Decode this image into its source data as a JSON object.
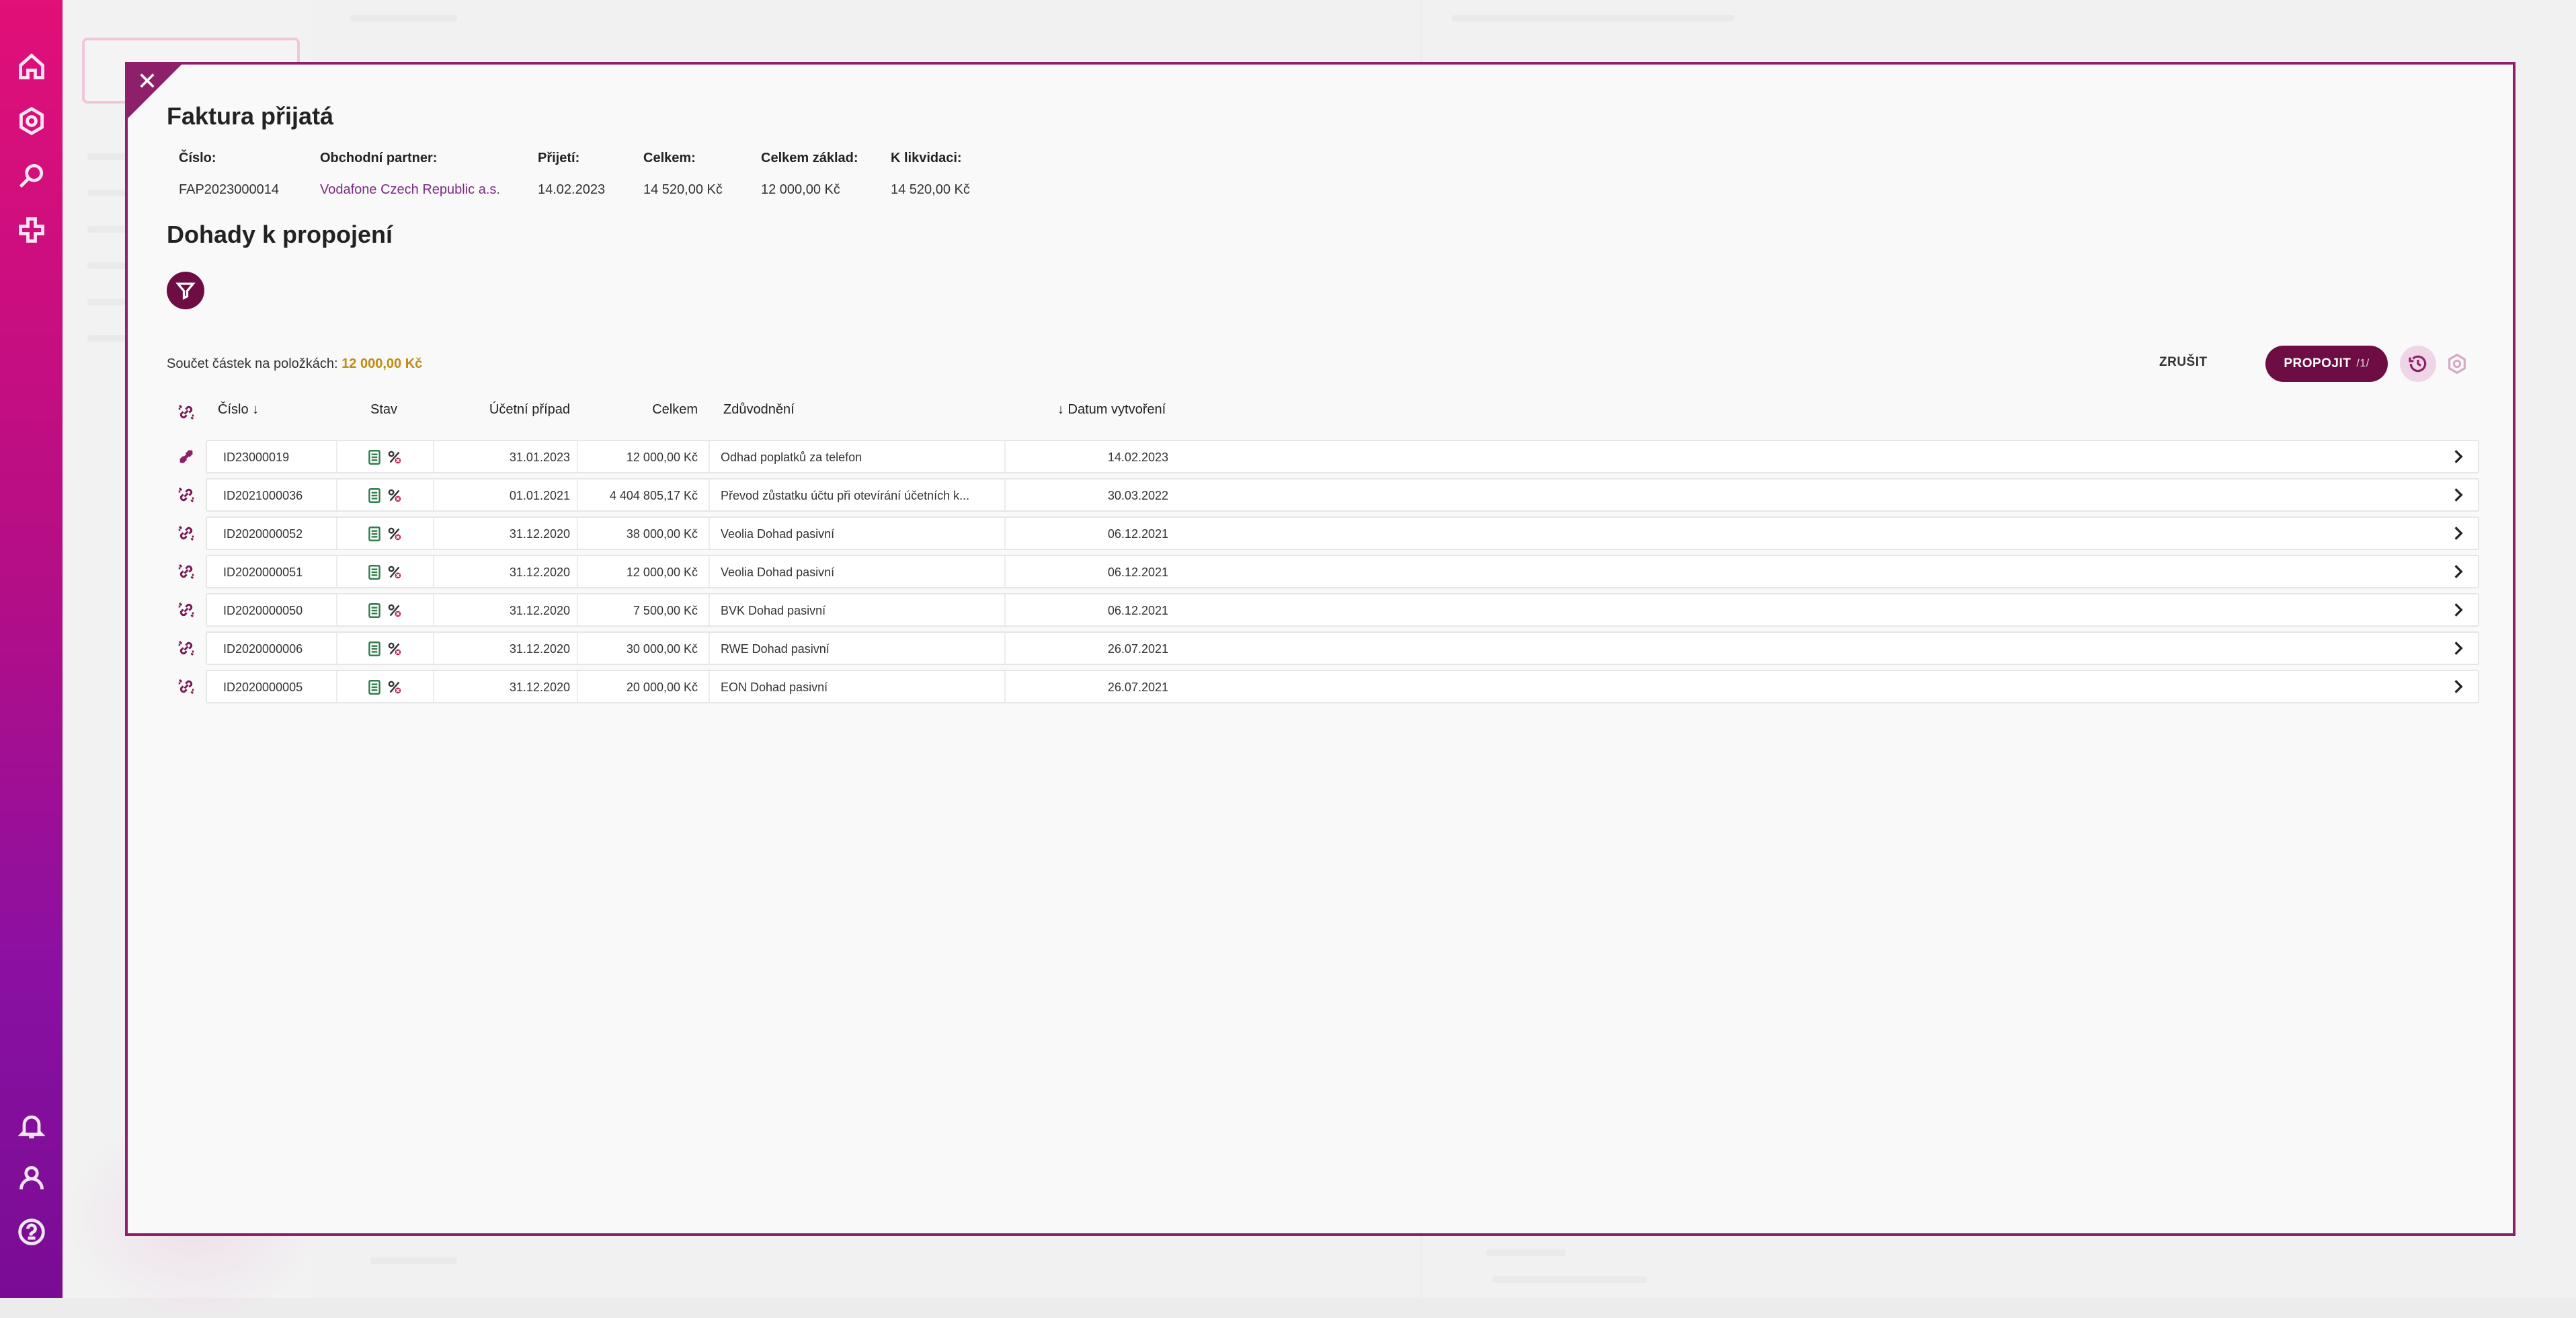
{
  "rail": {
    "top_icons": [
      "home-icon",
      "settings-icon",
      "search-icon",
      "plus-icon"
    ],
    "bottom_icons": [
      "bell-icon",
      "user-icon",
      "help-icon"
    ]
  },
  "modal": {
    "title": "Faktura přijatá",
    "info": [
      {
        "label": "Číslo:",
        "value": "FAP2023000014",
        "link": false
      },
      {
        "label": "Obchodní partner:",
        "value": "Vodafone Czech Republic a.s.",
        "link": true
      },
      {
        "label": "Přijetí:",
        "value": "14.02.2023",
        "link": false
      },
      {
        "label": "Celkem:",
        "value": "14 520,00 Kč",
        "link": false
      },
      {
        "label": "Celkem základ:",
        "value": "12 000,00 Kč",
        "link": false
      },
      {
        "label": "K likvidaci:",
        "value": "14 520,00 Kč",
        "link": false
      }
    ],
    "section_title": "Dohady k propojení",
    "sum_label": "Součet částek na položkách:",
    "sum_value": "12 000,00 Kč",
    "cancel_label": "ZRUŠIT",
    "link_label": "PROPOJIT",
    "link_count": "/1/",
    "table": {
      "headers": {
        "cislo": "Číslo ↓",
        "stav": "Stav",
        "ucetni_pripad": "Účetní případ",
        "celkem": "Celkem",
        "zduvodneni": "Zdůvodnění",
        "datum": "↓ Datum vytvoření"
      },
      "rows": [
        {
          "linked": true,
          "cislo": "ID23000019",
          "ucetni_pripad": "31.01.2023",
          "celkem": "12 000,00 Kč",
          "zduvodneni": "Odhad poplatků za telefon",
          "datum": "14.02.2023"
        },
        {
          "linked": false,
          "cislo": "ID2021000036",
          "ucetni_pripad": "01.01.2021",
          "celkem": "4 404 805,17 Kč",
          "zduvodneni": "Převod zůstatku účtu při otevírání účetních k...",
          "datum": "30.03.2022"
        },
        {
          "linked": false,
          "cislo": "ID2020000052",
          "ucetni_pripad": "31.12.2020",
          "celkem": "38 000,00 Kč",
          "zduvodneni": "Veolia Dohad pasivní",
          "datum": "06.12.2021"
        },
        {
          "linked": false,
          "cislo": "ID2020000051",
          "ucetni_pripad": "31.12.2020",
          "celkem": "12 000,00 Kč",
          "zduvodneni": "Veolia Dohad pasivní",
          "datum": "06.12.2021"
        },
        {
          "linked": false,
          "cislo": "ID2020000050",
          "ucetni_pripad": "31.12.2020",
          "celkem": "7 500,00 Kč",
          "zduvodneni": "BVK Dohad pasivní",
          "datum": "06.12.2021"
        },
        {
          "linked": false,
          "cislo": "ID2020000006",
          "ucetni_pripad": "31.12.2020",
          "celkem": "30 000,00 Kč",
          "zduvodneni": "RWE Dohad pasivní",
          "datum": "26.07.2021"
        },
        {
          "linked": false,
          "cislo": "ID2020000005",
          "ucetni_pripad": "31.12.2020",
          "celkem": "20 000,00 Kč",
          "zduvodneni": "EON Dohad pasivní",
          "datum": "26.07.2021"
        }
      ]
    }
  },
  "colors": {
    "accent": "#6d0d43",
    "modal_border": "#8e1f6a",
    "sum_amount": "#c28a10",
    "partner_link": "#7a2a82"
  }
}
